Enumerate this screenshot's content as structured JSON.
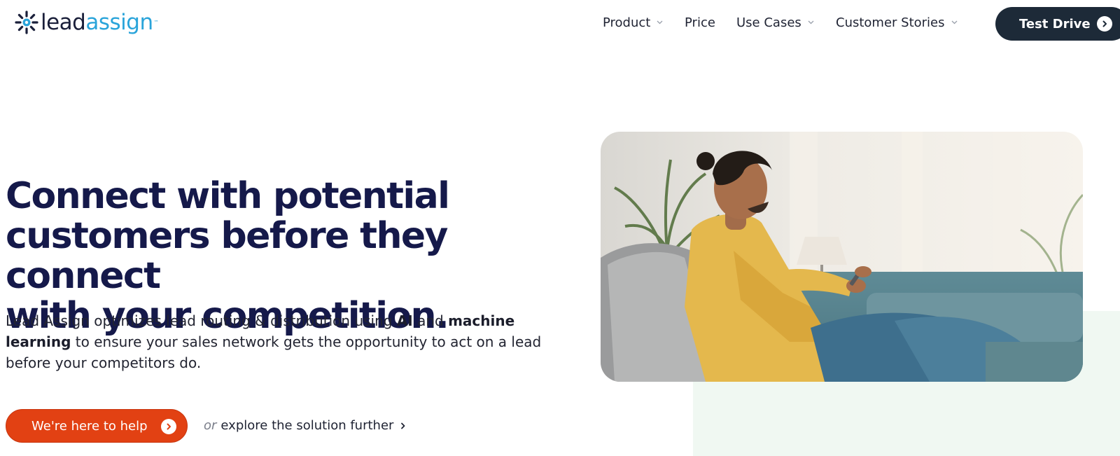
{
  "brand": {
    "name_part1": "lead",
    "name_part2": "assign",
    "tm": "™",
    "colors": {
      "navy": "#15194a",
      "blue": "#2aa4da",
      "orange": "#e24113",
      "dark_button": "#1d2a38",
      "mint": "#f0f8f2"
    }
  },
  "nav": {
    "items": [
      {
        "label": "Product",
        "has_dropdown": true
      },
      {
        "label": "Price",
        "has_dropdown": false
      },
      {
        "label": "Use Cases",
        "has_dropdown": true
      },
      {
        "label": "Customer Stories",
        "has_dropdown": true
      }
    ],
    "cta_label": "Test Drive"
  },
  "hero": {
    "headline_line1": "Connect with potential",
    "headline_line2": "customers before they connect",
    "headline_line3": "with your competition.",
    "sub_part1": "Lead Assign optimizes lead routing & distribution using ",
    "sub_bold1": "AI",
    "sub_part2": " and ",
    "sub_bold2": "machine learning",
    "sub_part3": " to ensure your sales network gets the opportunity to act on a lead before your competitors do.",
    "primary_button": "We're here to help",
    "or_text": "or",
    "explore_link": "explore the solution further"
  },
  "icons": {
    "logo": "sunburst-logo-icon",
    "dropdown": "chevron-down-icon",
    "button_arrow": "arrow-right-circle-icon",
    "link_arrow": "chevron-right-icon"
  }
}
